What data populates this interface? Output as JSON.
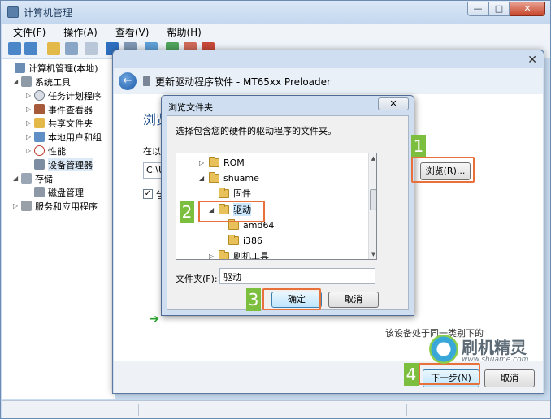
{
  "window": {
    "title": "计算机管理",
    "minimize": "—",
    "maximize": "□",
    "close": "✕"
  },
  "menu": [
    "文件(F)",
    "操作(A)",
    "查看(V)",
    "帮助(H)"
  ],
  "tree": [
    {
      "label": "计算机管理(本地)",
      "exp": "",
      "level": 0
    },
    {
      "label": "系统工具",
      "exp": "◢",
      "level": 1
    },
    {
      "label": "任务计划程序",
      "exp": "▷",
      "level": 2
    },
    {
      "label": "事件查看器",
      "exp": "▷",
      "level": 2
    },
    {
      "label": "共享文件夹",
      "exp": "▷",
      "level": 2
    },
    {
      "label": "本地用户和组",
      "exp": "▷",
      "level": 2
    },
    {
      "label": "性能",
      "exp": "▷",
      "level": 2
    },
    {
      "label": "设备管理器",
      "exp": "",
      "level": 2
    },
    {
      "label": "存储",
      "exp": "◢",
      "level": 1
    },
    {
      "label": "磁盘管理",
      "exp": "",
      "level": 2
    },
    {
      "label": "服务和应用程序",
      "exp": "▷",
      "level": 1
    }
  ],
  "wizard": {
    "close": "✕",
    "back": "←",
    "title": "更新驱动程序软件 - MT65xx Preloader",
    "heading": "浏览",
    "label": "在以",
    "path": "C:\\U",
    "dropdown": "▼",
    "browse": "浏览(R)...",
    "check_mark": "✓",
    "check_label": "包",
    "arrow": "➔",
    "option_text": "该设备处于同一类别下的",
    "next": "下一步(N)",
    "cancel": "取消"
  },
  "browse_dialog": {
    "title": "浏览文件夹",
    "close": "✕",
    "description": "选择包含您的硬件的驱动程序的文件夹。",
    "tree": [
      {
        "label": "ROM",
        "exp": "▷"
      },
      {
        "label": "shuame",
        "exp": "◢"
      },
      {
        "label": "固件",
        "exp": ""
      },
      {
        "label": "驱动",
        "exp": "◢",
        "selected": true
      },
      {
        "label": "amd64",
        "exp": ""
      },
      {
        "label": "i386",
        "exp": ""
      },
      {
        "label": "刷机工具",
        "exp": "▷"
      }
    ],
    "scroll_up": "▲",
    "scroll_down": "▼",
    "folder_label": "文件夹(F):",
    "folder_value": "驱动",
    "ok": "确定",
    "cancel": "取消"
  },
  "steps": [
    "1",
    "2",
    "3",
    "4"
  ],
  "watermark": {
    "name": "刷机精灵",
    "url": "www.shuame.com"
  },
  "colors": {
    "step_green": "#7cbe3d",
    "highlight_orange": "#e8703a"
  }
}
